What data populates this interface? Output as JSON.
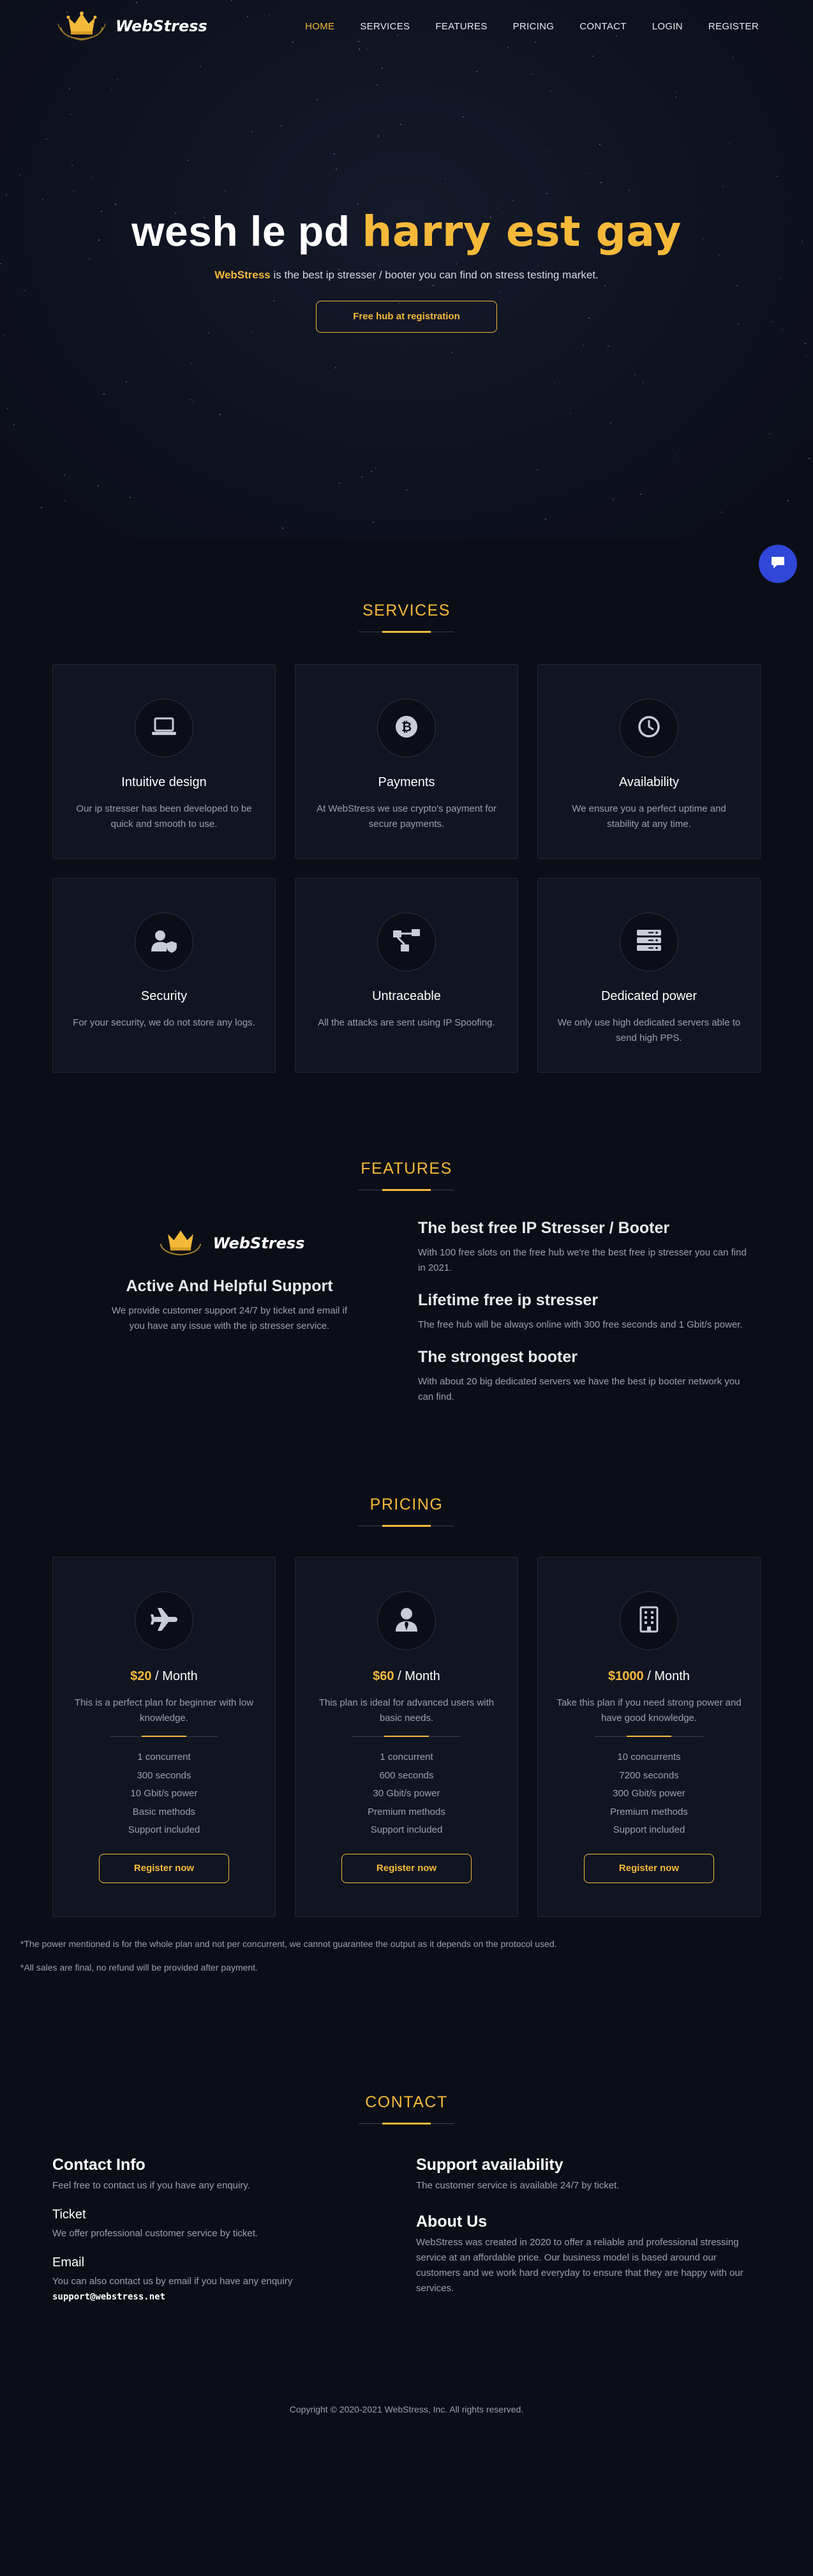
{
  "brand": {
    "name": "WebStress"
  },
  "nav": {
    "items": [
      {
        "label": "HOME",
        "active": true
      },
      {
        "label": "SERVICES",
        "active": false
      },
      {
        "label": "FEATURES",
        "active": false
      },
      {
        "label": "PRICING",
        "active": false
      },
      {
        "label": "CONTACT",
        "active": false
      },
      {
        "label": "LOGIN",
        "active": false
      },
      {
        "label": "REGISTER",
        "active": false
      }
    ]
  },
  "hero": {
    "title_white": "wesh le pd",
    "title_gold": "harry est gay",
    "subtitle_brand": "WebStress",
    "subtitle_rest": " is the best ip stresser / booter you can find on stress testing market.",
    "button": "Free hub at registration"
  },
  "services": {
    "title": "SERVICES",
    "items": [
      {
        "icon": "laptop-icon",
        "title": "Intuitive design",
        "text": "Our ip stresser has been developed to be quick and smooth to use."
      },
      {
        "icon": "bitcoin-icon",
        "title": "Payments",
        "text": "At WebStress we use crypto's payment for secure payments."
      },
      {
        "icon": "clock-icon",
        "title": "Availability",
        "text": "We ensure you a perfect uptime and stability at any time."
      },
      {
        "icon": "user-shield-icon",
        "title": "Security",
        "text": "For your security, we do not store any logs."
      },
      {
        "icon": "network-icon",
        "title": "Untraceable",
        "text": "All the attacks are sent using IP Spoofing."
      },
      {
        "icon": "server-icon",
        "title": "Dedicated power",
        "text": "We only use high dedicated servers able to send high PPS."
      }
    ]
  },
  "features": {
    "title": "FEATURES",
    "left_title": "Active And Helpful Support",
    "left_text": "We provide customer support 24/7 by ticket and email if you have any issue with the ip stresser service.",
    "items": [
      {
        "title": "The best free IP Stresser / Booter",
        "text": "With 100 free slots on the free hub we're the best free ip stresser you can find in 2021."
      },
      {
        "title": "Lifetime free ip stresser",
        "text": "The free hub will be always online with 300 free seconds and 1 Gbit/s power."
      },
      {
        "title": "The strongest booter",
        "text": "With about 20 big dedicated servers we have the best ip booter network you can find."
      }
    ]
  },
  "pricing": {
    "title": "PRICING",
    "plans": [
      {
        "icon": "plane-icon",
        "price": "$20",
        "period": " / Month",
        "desc": "This is a perfect plan for beginner with low knowledge.",
        "features": [
          "1 concurrent",
          "300 seconds",
          "10 Gbit/s power",
          "Basic methods",
          "Support included"
        ],
        "button": "Register now"
      },
      {
        "icon": "user-tie-icon",
        "price": "$60",
        "period": " / Month",
        "desc": "This plan is ideal for advanced users with basic needs.",
        "features": [
          "1 concurrent",
          "600 seconds",
          "30 Gbit/s power",
          "Premium methods",
          "Support included"
        ],
        "button": "Register now"
      },
      {
        "icon": "building-icon",
        "price": "$1000",
        "period": " / Month",
        "desc": "Take this plan if you need strong power and have good knowledge.",
        "features": [
          "10 concurrents",
          "7200 seconds",
          "300 Gbit/s power",
          "Premium methods",
          "Support included"
        ],
        "button": "Register now"
      }
    ],
    "note1": "*The power mentioned is for the whole plan and not per concurrent, we cannot guarantee the output as it depends on the protocol used.",
    "note2": "*All sales are final, no refund will be provided after payment."
  },
  "contact": {
    "title": "CONTACT",
    "info_title": "Contact Info",
    "info_text": "Feel free to contact us if you have any enquiry.",
    "ticket_title": "Ticket",
    "ticket_text": "We offer professional customer service by ticket.",
    "email_title": "Email",
    "email_text": "You can also contact us by email if you have any enquiry",
    "email": "support@webstress.net",
    "support_title": "Support availability",
    "support_text": "The customer service is available 24/7 by ticket.",
    "about_title": "About Us",
    "about_text": "WebStress was created in 2020 to offer a reliable and professional stressing service at an affordable price. Our business model is based around our customers and we work hard everyday to ensure that they are happy with our services."
  },
  "footer": {
    "copyright": "Copyright © 2020-2021 WebStress, Inc. All rights reserved."
  },
  "colors": {
    "accent": "#f5b93a",
    "background": "#0b0e17",
    "card": "#111522",
    "chat": "#2f46d8"
  }
}
